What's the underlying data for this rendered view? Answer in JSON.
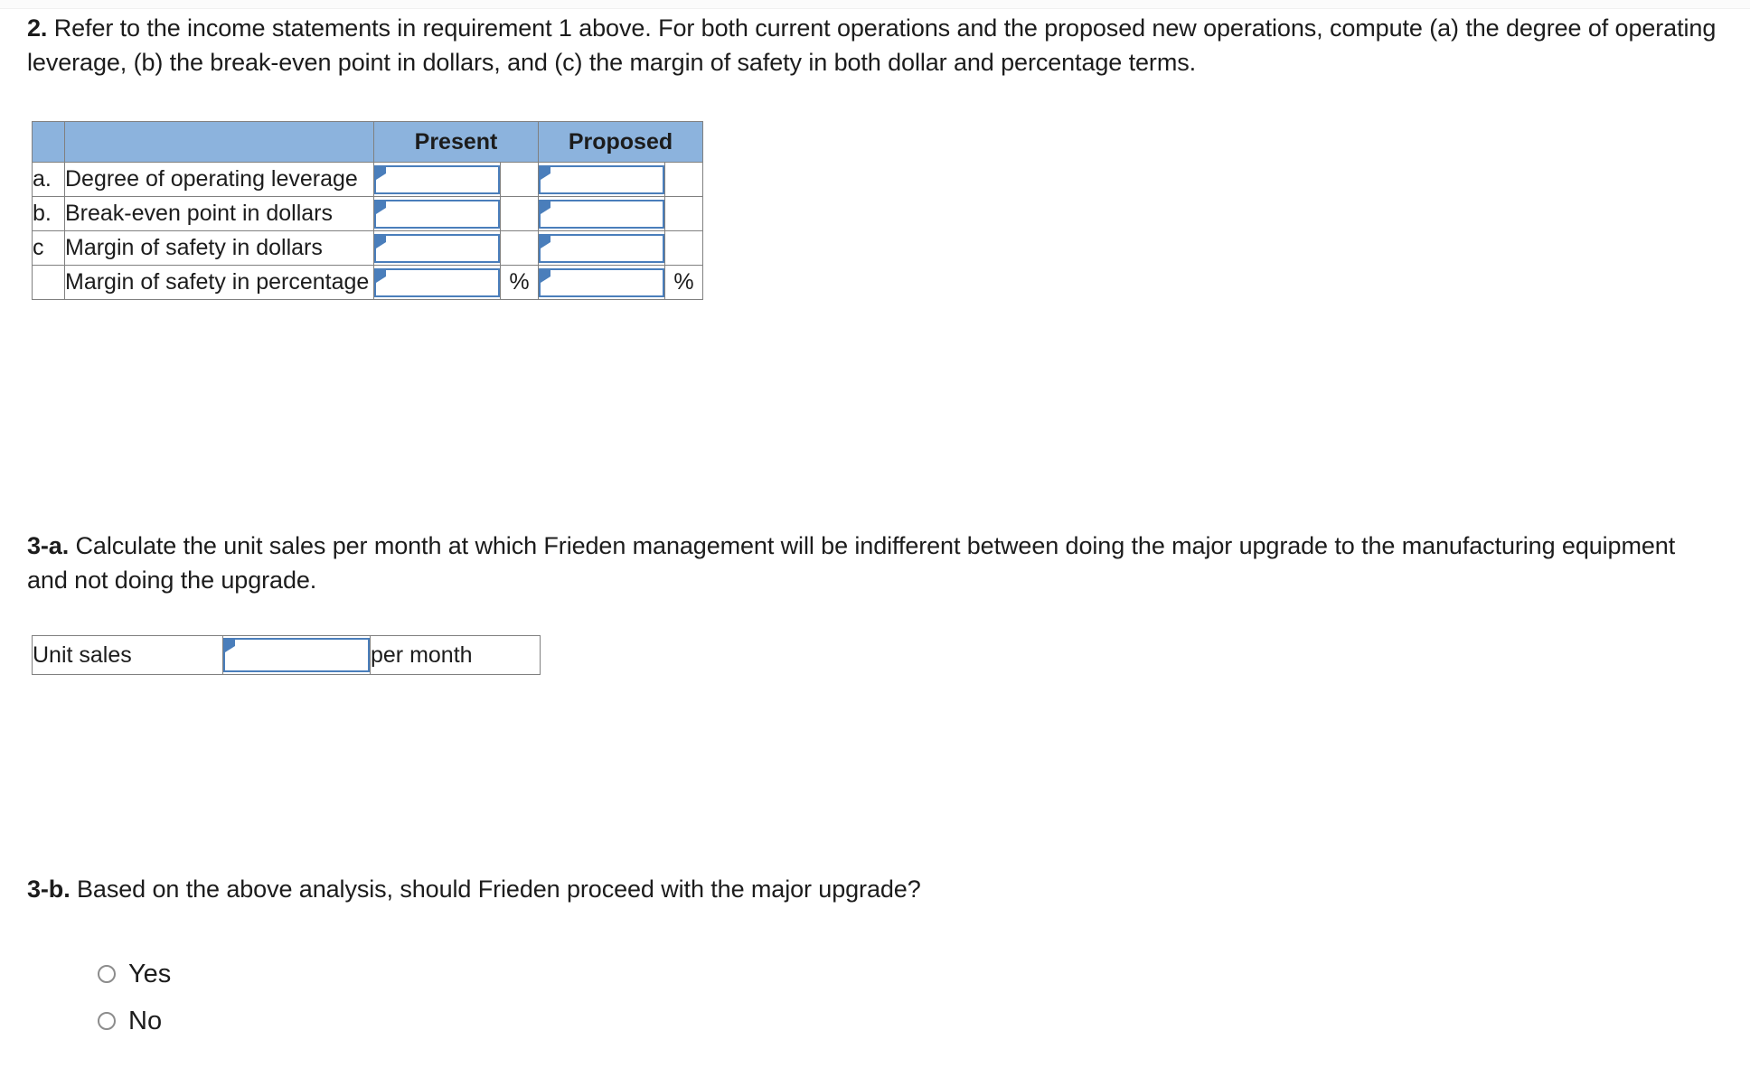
{
  "questions": {
    "q2_number": "2.",
    "q2_text": " Refer to the income statements in requirement 1 above. For both current operations and the proposed new operations, compute (a) the degree of operating leverage, (b) the break-even point in dollars, and (c) the margin of safety in both dollar and percentage terms.",
    "q3a_number": "3-a.",
    "q3a_text": " Calculate the unit sales per month at which Frieden management will be indifferent between doing the major upgrade to the manufacturing equipment and not doing the upgrade.",
    "q3b_number": "3-b.",
    "q3b_text": " Based on the above analysis, should Frieden proceed with the major upgrade?"
  },
  "answer_table": {
    "headers": {
      "blank_letter": "",
      "blank_label": "",
      "present": "Present",
      "proposed": "Proposed"
    },
    "rows": [
      {
        "letter": "a.",
        "label": "Degree of operating leverage",
        "present_value": "",
        "present_suffix": "",
        "proposed_value": "",
        "proposed_suffix": ""
      },
      {
        "letter": "b.",
        "label": "Break-even point in dollars",
        "present_value": "",
        "present_suffix": "",
        "proposed_value": "",
        "proposed_suffix": ""
      },
      {
        "letter": "c",
        "label": "Margin of safety in dollars",
        "present_value": "",
        "present_suffix": "",
        "proposed_value": "",
        "proposed_suffix": ""
      },
      {
        "letter": "",
        "label": "Margin of safety in percentage",
        "present_value": "",
        "present_suffix": "%",
        "proposed_value": "",
        "proposed_suffix": "%"
      }
    ]
  },
  "unit_sales": {
    "label": "Unit sales",
    "value": "",
    "suffix": "per month"
  },
  "radio_options": [
    {
      "label": "Yes",
      "selected": false
    },
    {
      "label": "No",
      "selected": false
    }
  ],
  "colors": {
    "header_blue": "#8cb3dd",
    "input_border_blue": "#4a7ebb",
    "table_border_gray": "#808080",
    "text": "#1c1c1c"
  }
}
